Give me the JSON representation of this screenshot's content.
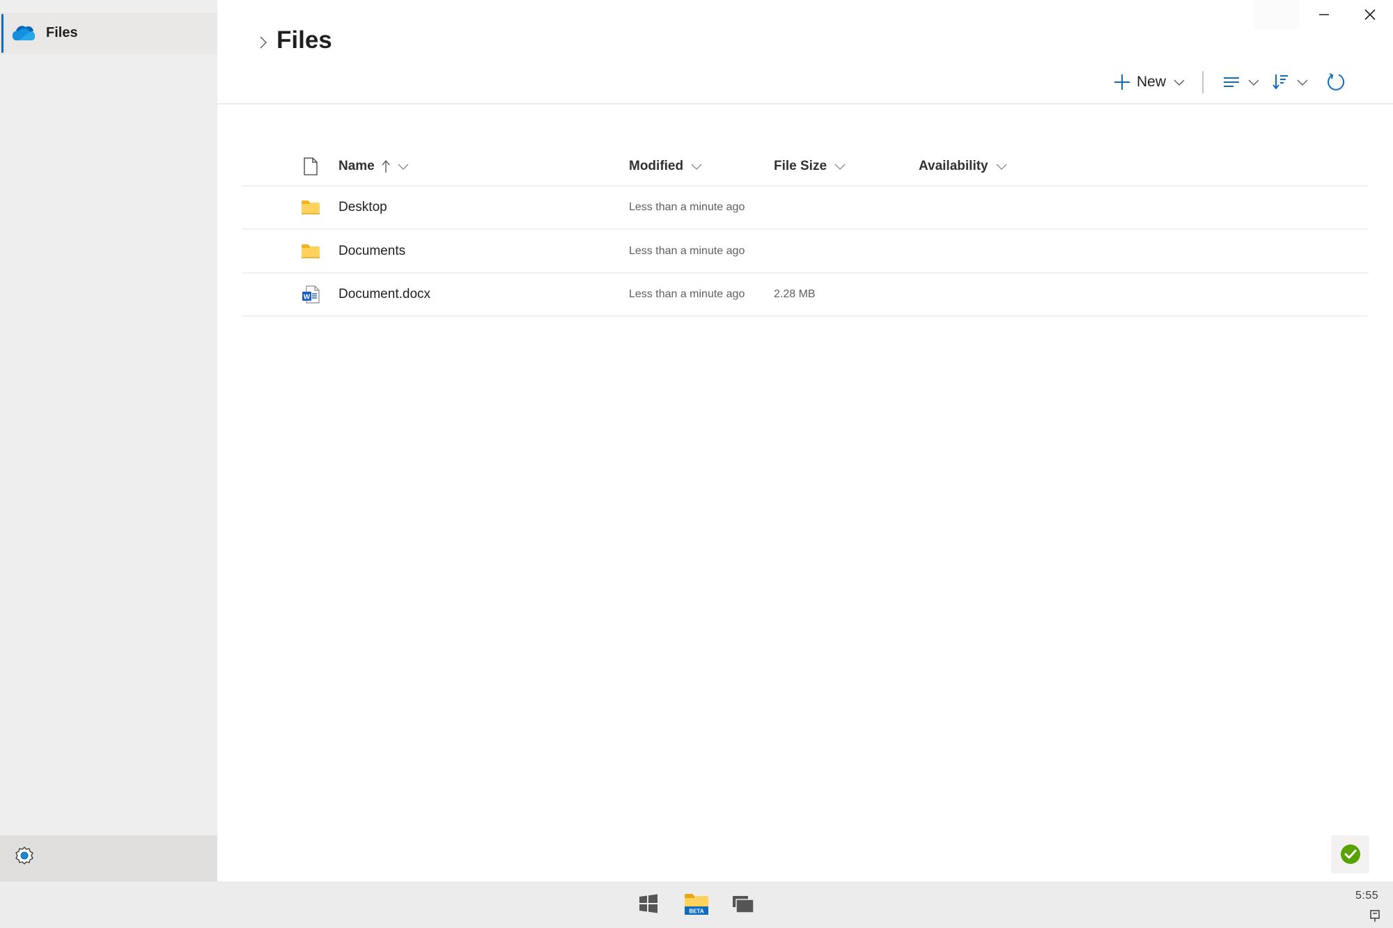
{
  "window": {
    "title": "Files",
    "controls": {
      "minimize": "minimize-icon",
      "close": "close-icon"
    }
  },
  "sidebar": {
    "items": [
      {
        "label": "Files",
        "icon": "onedrive-cloud-icon",
        "selected": true
      }
    ],
    "settings_icon": "gear-icon"
  },
  "header": {
    "breadcrumb_icon": "chevron-right-icon",
    "title": "Files"
  },
  "toolbar": {
    "new_label": "New",
    "new_icon": "plus-icon",
    "view_icon": "view-options-icon",
    "sort_icon": "sort-icon",
    "refresh_icon": "refresh-icon"
  },
  "table": {
    "columns": [
      {
        "key": "type",
        "label": "",
        "icon": "file-type-icon"
      },
      {
        "key": "name",
        "label": "Name",
        "sorted": "ascending"
      },
      {
        "key": "modified",
        "label": "Modified"
      },
      {
        "key": "size",
        "label": "File Size"
      },
      {
        "key": "availability",
        "label": "Availability"
      }
    ],
    "rows": [
      {
        "type": "folder",
        "name": "Desktop",
        "modified": "Less than a minute ago",
        "size": "",
        "availability": ""
      },
      {
        "type": "folder",
        "name": "Documents",
        "modified": "Less than a minute ago",
        "size": "",
        "availability": ""
      },
      {
        "type": "word",
        "name": "Document.docx",
        "modified": "Less than a minute ago",
        "size": "2.28 MB",
        "availability": ""
      }
    ]
  },
  "status": {
    "icon": "sync-complete-check-icon",
    "color": "#57a300"
  },
  "taskbar": {
    "start_icon": "windows-logo-icon",
    "app_icon": "files-beta-folder-icon",
    "app_badge": "BETA",
    "task_view_icon": "task-view-icon",
    "clock": "5:55",
    "tray_icon": "plug-icon"
  },
  "colors": {
    "accent": "#0f6cbd",
    "folder": "#ffd35b",
    "word": "#185abd",
    "success": "#57a300"
  }
}
